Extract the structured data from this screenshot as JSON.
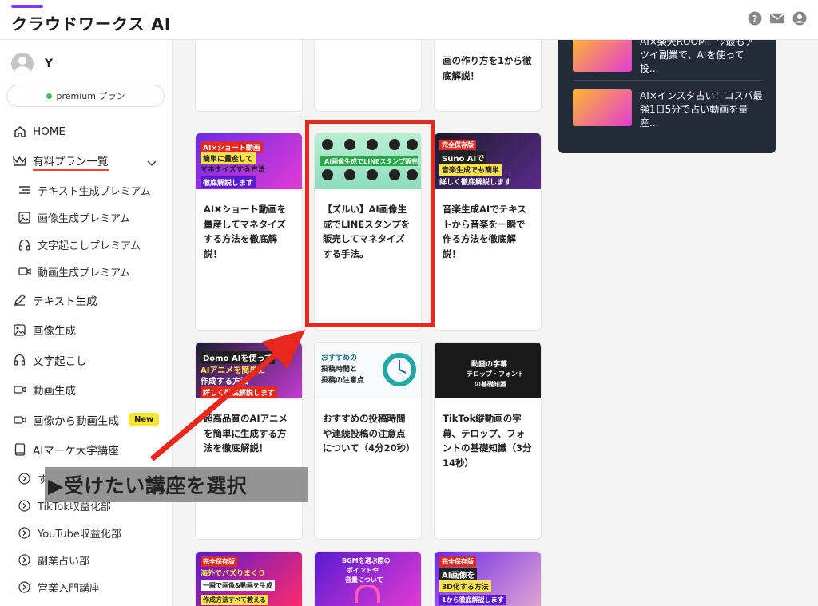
{
  "header": {
    "logo": "クラウドワークス AI",
    "icons": [
      "help-icon",
      "mail-icon",
      "account-icon"
    ]
  },
  "sidebar": {
    "user_name": "Y",
    "plan": "premium プラン",
    "items": [
      {
        "label": "HOME",
        "icon": "home-icon"
      },
      {
        "label": "有料プラン一覧",
        "icon": "crown-icon"
      },
      {
        "label": "テキスト生成プレミアム",
        "icon": "lines-icon"
      },
      {
        "label": "画像生成プレミアム",
        "icon": "image-icon"
      },
      {
        "label": "文字起こしプレミアム",
        "icon": "headphone-icon"
      },
      {
        "label": "動画生成プレミアム",
        "icon": "video-icon"
      },
      {
        "label": "テキスト生成",
        "icon": "pen-icon"
      },
      {
        "label": "画像生成",
        "icon": "image-icon"
      },
      {
        "label": "文字起こし",
        "icon": "headphone-icon"
      },
      {
        "label": "動画生成",
        "icon": "video-icon"
      },
      {
        "label": "画像から動画生成",
        "icon": "video-icon",
        "badge": "New"
      },
      {
        "label": "AIマーケ大学講座",
        "icon": "book-icon"
      },
      {
        "label": "す",
        "icon": "circle-chevron-icon"
      },
      {
        "label": "TikTok収益化部",
        "icon": "circle-chevron-icon"
      },
      {
        "label": "YouTube収益化部",
        "icon": "circle-chevron-icon"
      },
      {
        "label": "副業占い部",
        "icon": "circle-chevron-icon"
      },
      {
        "label": "営業入門講座",
        "icon": "circle-chevron-icon"
      }
    ]
  },
  "top_cards": [
    {
      "title": "画の作り方を1から徹底解説！"
    }
  ],
  "cards": [
    {
      "title": "AI✖ショート動画を量産してマネタイズする方法を徹底解説！",
      "thumb": [
        "AI×ショート動画",
        "簡単に量産して",
        "マネタイズする方法",
        "徹底解説します"
      ]
    },
    {
      "title": "【ズルい】AI画像生成でLINEスタンプを販売してマネタイズする手法。",
      "thumb": [
        "AI画像生成でLINEスタンプ販売"
      ]
    },
    {
      "title": "音楽生成AIでテキストから音楽を一瞬で作る方法を徹底解説！",
      "thumb": [
        "完全保存版",
        "Suno AIで",
        "音楽生成でも簡単",
        "詳しく徹底解説します"
      ]
    },
    {
      "title": "超高品質のAIアニメを簡単に生成する方法を徹底解説！",
      "thumb": [
        "Domo AIを使って",
        "AIアニメを簡単に",
        "作成する方法",
        "詳しく徹底解説します"
      ]
    },
    {
      "title": "おすすめの投稿時間や連続投稿の注意点について（4分20秒）",
      "thumb": [
        "おすすめの",
        "投稿時間と",
        "投稿の注意点"
      ]
    },
    {
      "title": "TikTok縦動画の字幕、テロップ、フォントの基礎知識（3分14秒）",
      "thumb": [
        "動画の字幕",
        "テロップ・フォント",
        "の基礎知識"
      ]
    },
    {
      "title": "",
      "thumb": [
        "完全保存版",
        "海外でバズりまくり",
        "一瞬で画像&動画を生成",
        "作成方法すべて教える"
      ]
    },
    {
      "title": "",
      "thumb": [
        "BGMを選ぶ際の",
        "ポイントや",
        "音量について"
      ]
    },
    {
      "title": "",
      "thumb": [
        "完全保存版",
        "AI画像を",
        "3D化する方法",
        "1から徹底解説します"
      ]
    }
  ],
  "side_panel": [
    {
      "text": "AI×楽天ROOM！今最もアツイ副業で、AIを使って投..."
    },
    {
      "text": "AI×インスタ占い！コスパ最強1日5分で占い動画を量産..."
    }
  ],
  "callout": "▶受けたい講座を選択"
}
